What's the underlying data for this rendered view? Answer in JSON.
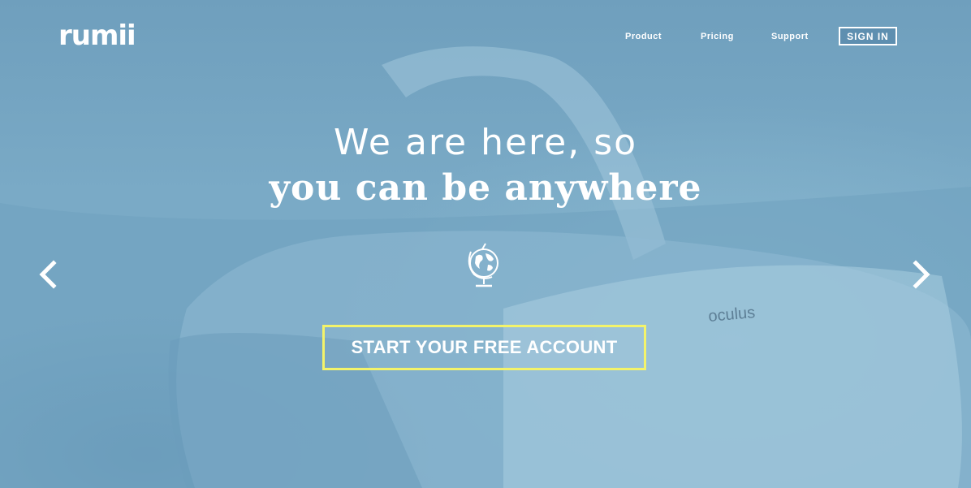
{
  "brand": {
    "logo_text": "rumii"
  },
  "nav": {
    "items": [
      {
        "label": "Product"
      },
      {
        "label": "Pricing"
      },
      {
        "label": "Support"
      }
    ],
    "sign_in_label": "SIGN IN"
  },
  "hero": {
    "headline_line1": "We are here, so",
    "headline_line2": "you can be anywhere",
    "cta_label": "START YOUR FREE ACCOUNT",
    "background_text": "oculus",
    "center_icon": "globe-icon",
    "prev_icon": "chevron-left-icon",
    "next_icon": "chevron-right-icon"
  },
  "colors": {
    "overlay_blue": "#7aaac6",
    "cta_border": "#f3f36a",
    "text": "#ffffff"
  }
}
